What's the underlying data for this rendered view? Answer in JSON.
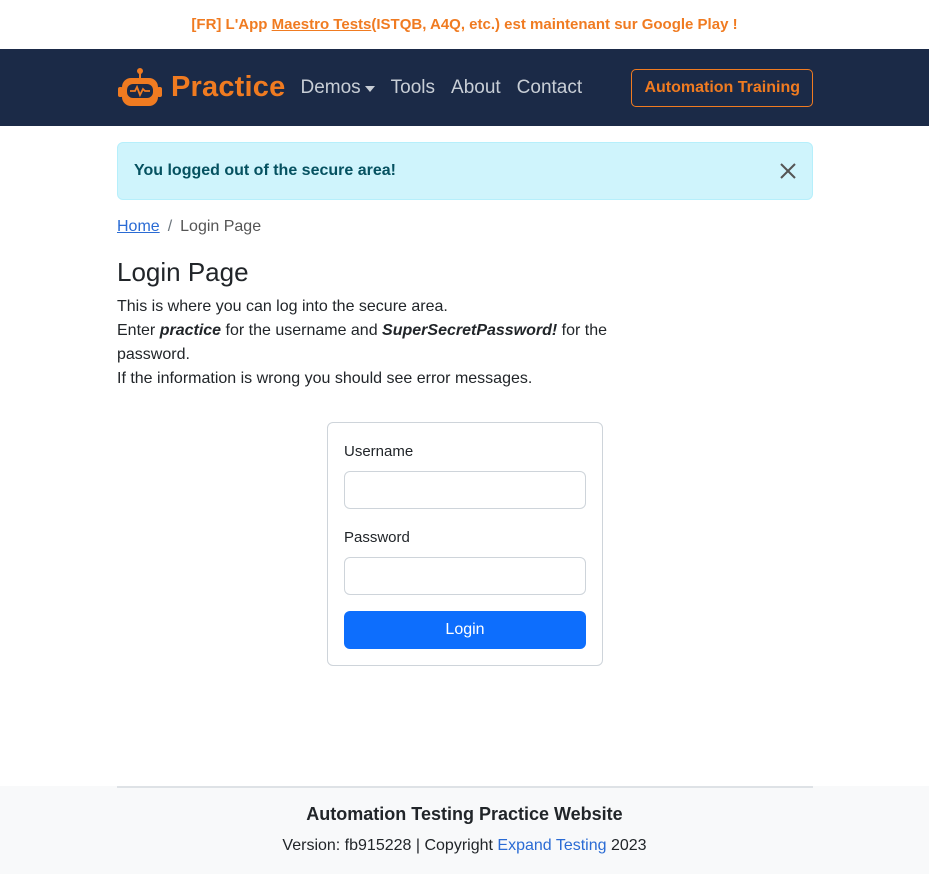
{
  "banner": {
    "prefix": "[FR] L'App ",
    "link": "Maestro Tests",
    "suffix": " (ISTQB, A4Q, etc.) est maintenant sur Google Play !"
  },
  "nav": {
    "brand": "Practice",
    "links": [
      "Demos",
      "Tools",
      "About",
      "Contact"
    ],
    "cta": "Automation Training"
  },
  "alert": {
    "message": "You logged out of the secure area!"
  },
  "breadcrumb": {
    "home": "Home",
    "separator": "/",
    "current": "Login Page"
  },
  "page": {
    "title": "Login Page",
    "line1": "This is where you can log into the secure area.",
    "line2_prefix": "Enter ",
    "username_hint": "practice",
    "line2_mid": " for the username and ",
    "password_hint": "SuperSecretPassword!",
    "line2_suffix": " for the password.",
    "line3": "If the information is wrong you should see error messages."
  },
  "form": {
    "username_label": "Username",
    "username_value": "",
    "password_label": "Password",
    "password_value": "",
    "submit": "Login"
  },
  "footer": {
    "title": "Automation Testing Practice Website",
    "version_prefix": "Version: fb915228 | Copyright ",
    "company": "Expand Testing",
    "year": " 2023"
  },
  "colors": {
    "brand_orange": "#f07b21",
    "navbar_bg": "#1b2a47",
    "alert_bg": "#cff4fc",
    "primary": "#0d6efd"
  }
}
